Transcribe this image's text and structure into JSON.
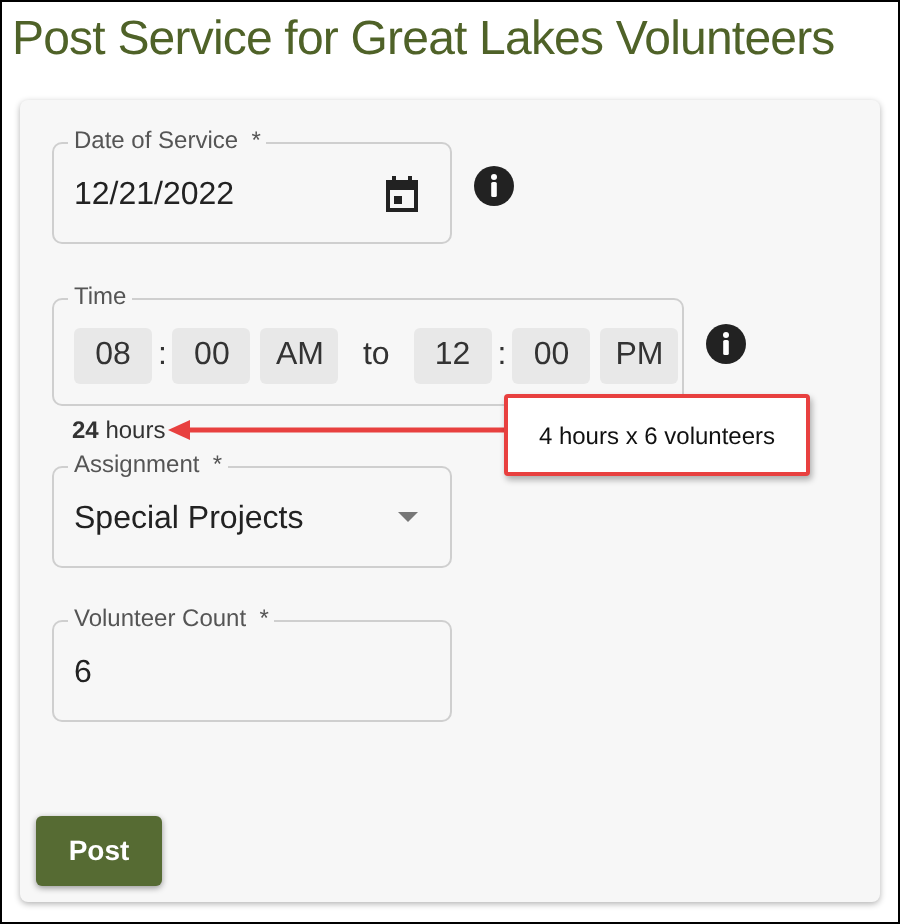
{
  "title": "Post Service for Great Lakes Volunteers",
  "date_field": {
    "label": "Date of Service  *",
    "value": "12/21/2022"
  },
  "time_field": {
    "label": "Time",
    "parts": [
      {
        "kind": "segment",
        "text": "08"
      },
      {
        "kind": "separator",
        "text": ":"
      },
      {
        "kind": "segment",
        "text": "00"
      },
      {
        "kind": "segment",
        "text": "AM"
      },
      {
        "kind": "word",
        "text": "to"
      },
      {
        "kind": "segment",
        "text": "12"
      },
      {
        "kind": "separator",
        "text": ":"
      },
      {
        "kind": "segment",
        "text": "00"
      },
      {
        "kind": "segment",
        "text": "PM"
      }
    ]
  },
  "total": "**24** hours",
  "callout": "4 hours x 6 volunteers",
  "assignment_field": {
    "label": "Assignment  *",
    "value": "Special Projects"
  },
  "count_field": {
    "label": "Volunteer Count  *",
    "value": "6"
  },
  "post_button": "Post"
}
